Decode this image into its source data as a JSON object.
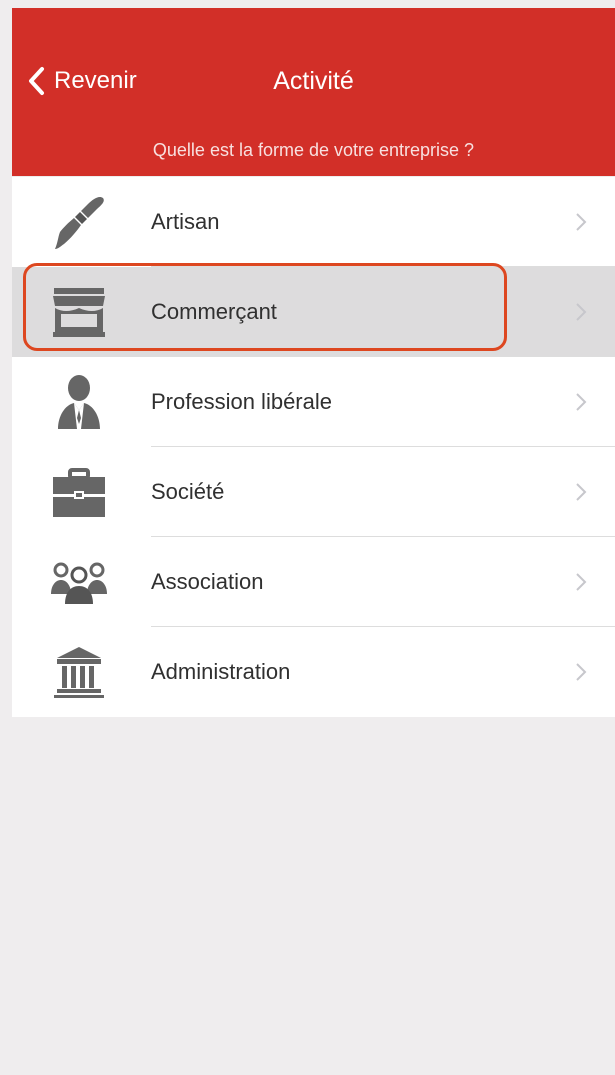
{
  "header": {
    "back_label": "Revenir",
    "title": "Activité",
    "subtitle": "Quelle est la forme de votre entreprise ?",
    "background_color": "#d22f28"
  },
  "list": {
    "items": [
      {
        "label": "Artisan",
        "icon": "paintbrush-icon",
        "selected": false
      },
      {
        "label": "Commerçant",
        "icon": "storefront-icon",
        "selected": true
      },
      {
        "label": "Profession libérale",
        "icon": "person-suit-icon",
        "selected": false
      },
      {
        "label": "Société",
        "icon": "briefcase-icon",
        "selected": false
      },
      {
        "label": "Association",
        "icon": "people-group-icon",
        "selected": false
      },
      {
        "label": "Administration",
        "icon": "government-building-icon",
        "selected": false
      }
    ]
  },
  "colors": {
    "accent_red": "#d22f28",
    "highlight_orange": "#dd4720",
    "icon_gray": "#666666"
  }
}
